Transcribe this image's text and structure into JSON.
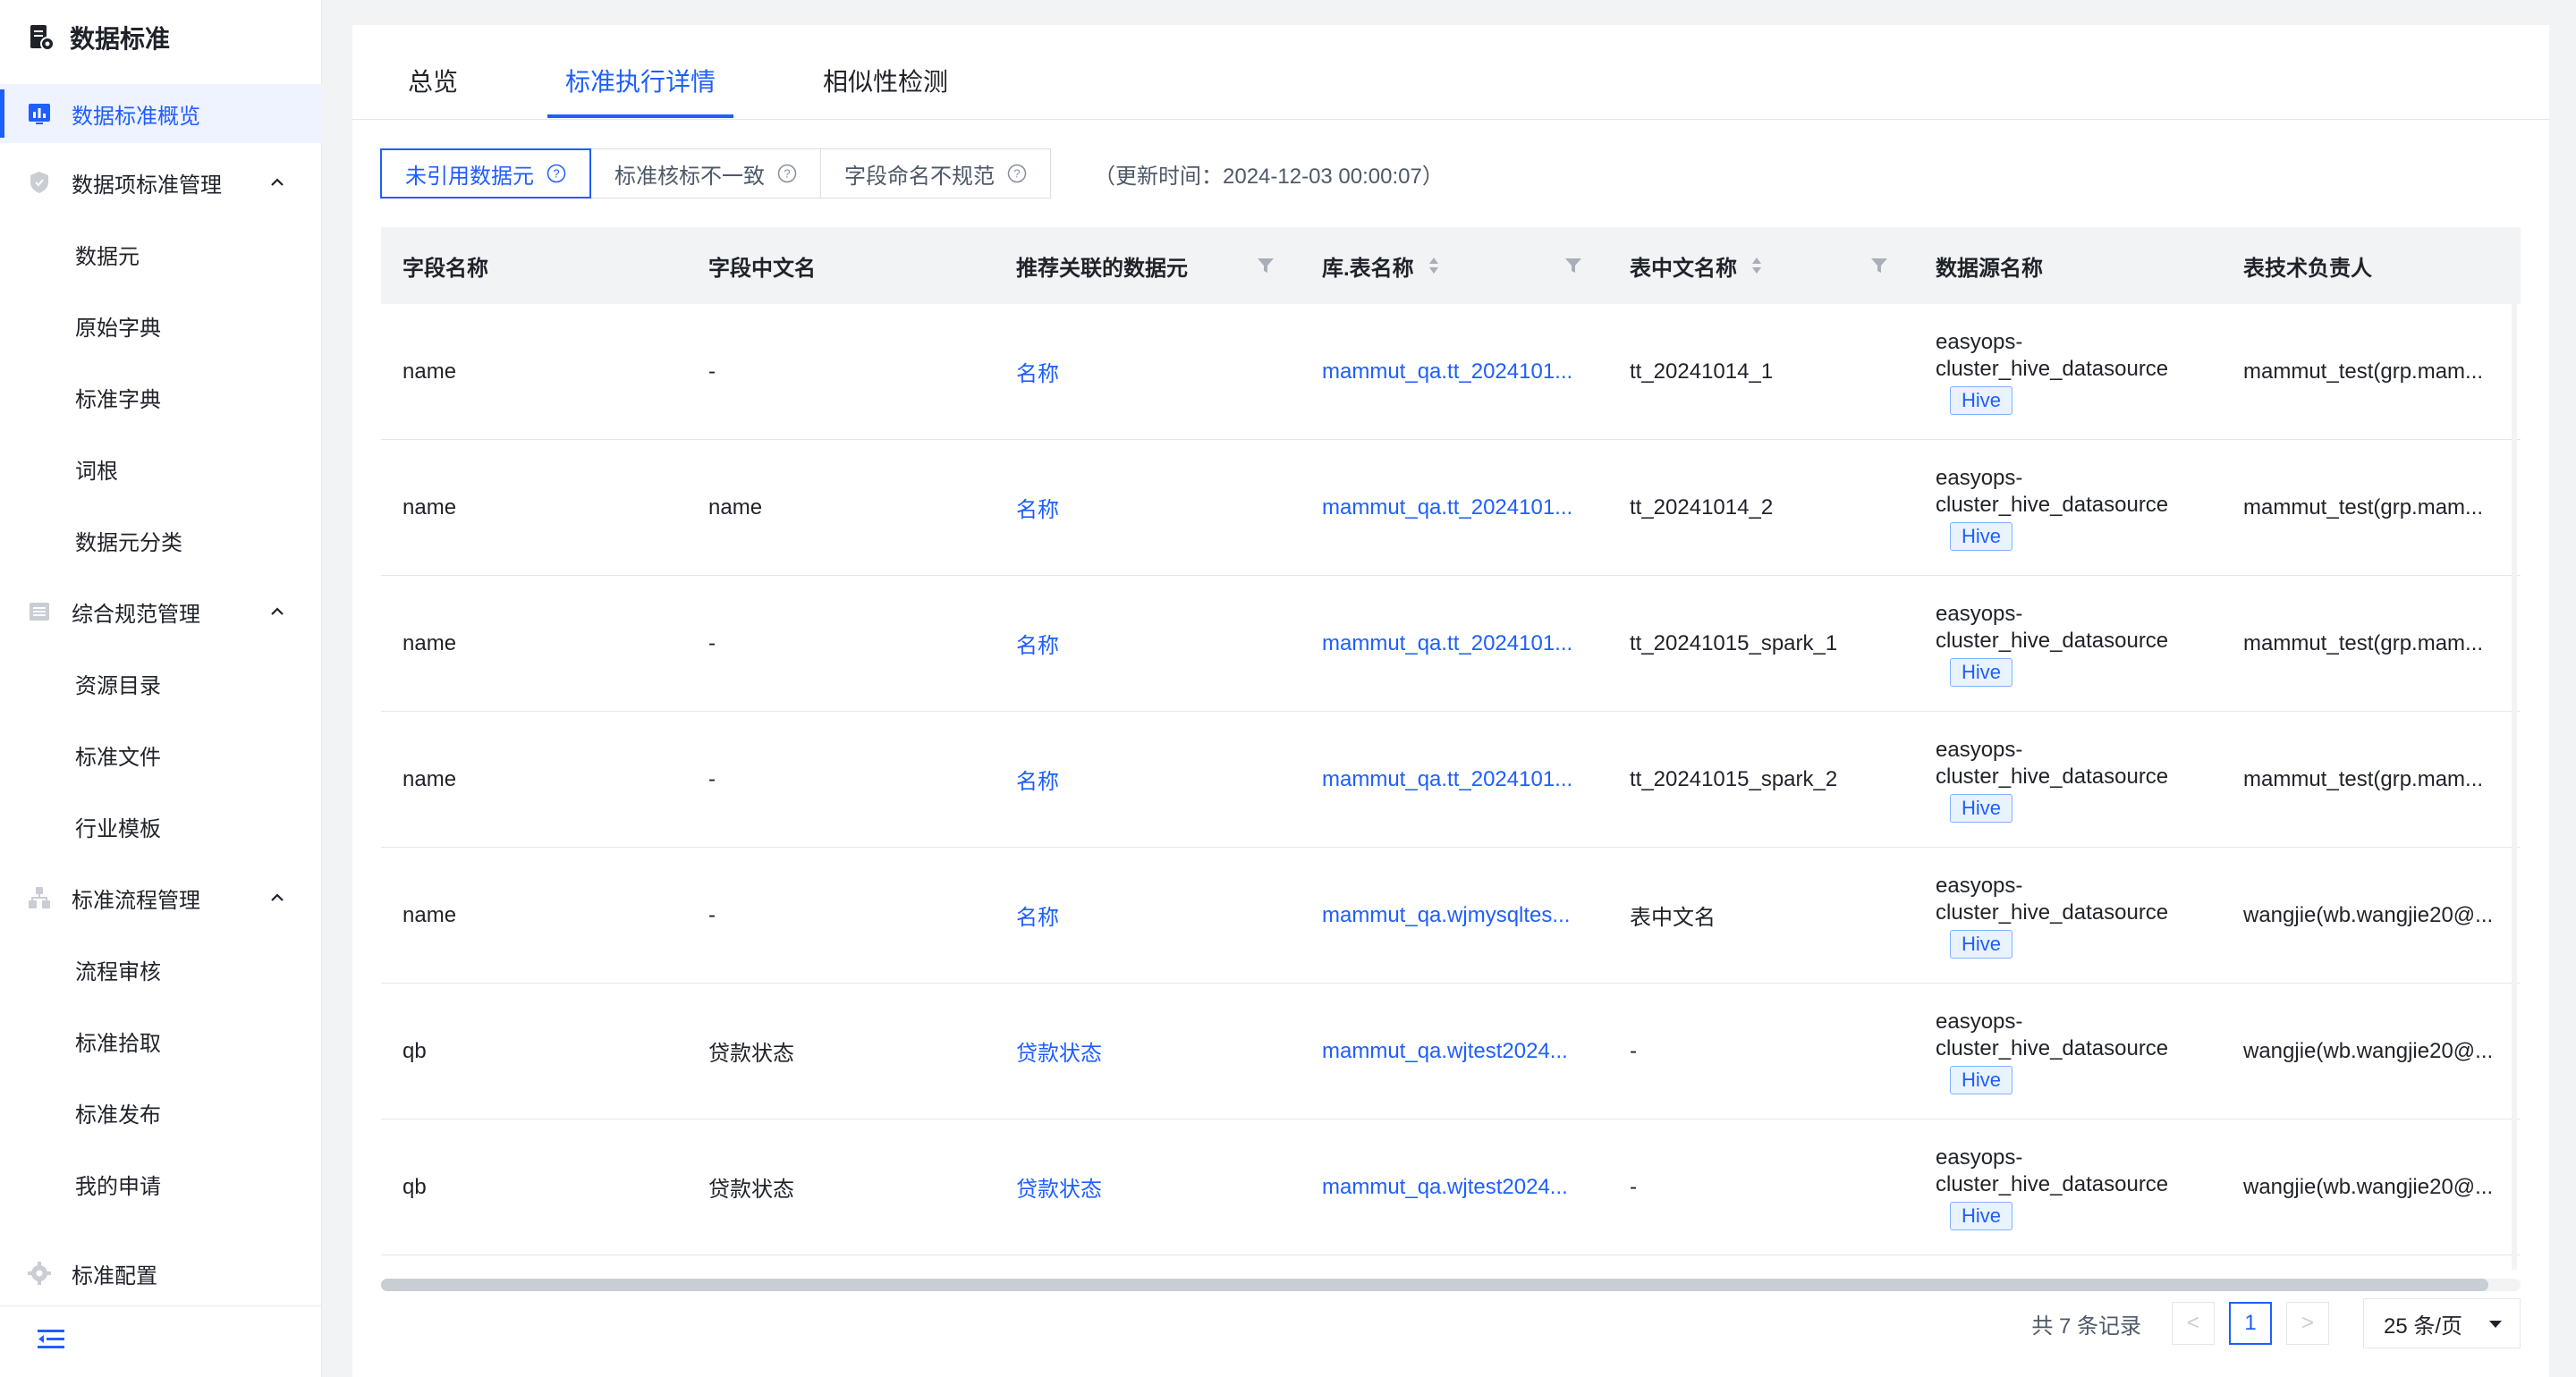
{
  "app": {
    "title": "数据标准"
  },
  "sidebar": {
    "items": [
      {
        "label": "数据标准概览",
        "type": "item",
        "active": true,
        "icon": "chart-icon"
      },
      {
        "label": "数据项标准管理",
        "type": "group",
        "icon": "shield-icon"
      },
      {
        "label": "数据元",
        "type": "sub"
      },
      {
        "label": "原始字典",
        "type": "sub"
      },
      {
        "label": "标准字典",
        "type": "sub"
      },
      {
        "label": "词根",
        "type": "sub"
      },
      {
        "label": "数据元分类",
        "type": "sub"
      },
      {
        "label": "综合规范管理",
        "type": "group",
        "icon": "list-icon"
      },
      {
        "label": "资源目录",
        "type": "sub"
      },
      {
        "label": "标准文件",
        "type": "sub"
      },
      {
        "label": "行业模板",
        "type": "sub"
      },
      {
        "label": "标准流程管理",
        "type": "group",
        "icon": "org-icon"
      },
      {
        "label": "流程审核",
        "type": "sub"
      },
      {
        "label": "标准拾取",
        "type": "sub"
      },
      {
        "label": "标准发布",
        "type": "sub"
      },
      {
        "label": "我的申请",
        "type": "sub"
      },
      {
        "label": "标准配置",
        "type": "group",
        "icon": "gear-icon"
      }
    ],
    "collapse_icon": "menu-collapse-icon"
  },
  "tabs": [
    {
      "label": "总览",
      "active": false
    },
    {
      "label": "标准执行详情",
      "active": true
    },
    {
      "label": "相似性检测",
      "active": false
    }
  ],
  "filters": [
    {
      "label": "未引用数据元",
      "active": true
    },
    {
      "label": "标准核标不一致",
      "active": false
    },
    {
      "label": "字段命名不规范",
      "active": false
    }
  ],
  "update_time": "（更新时间：2024-12-03 00:00:07）",
  "table": {
    "columns": [
      {
        "label": "字段名称",
        "sort": false,
        "filter": false
      },
      {
        "label": "字段中文名",
        "sort": false,
        "filter": false
      },
      {
        "label": "推荐关联的数据元",
        "sort": false,
        "filter": true
      },
      {
        "label": "库.表名称",
        "sort": true,
        "filter": true
      },
      {
        "label": "表中文名称",
        "sort": true,
        "filter": true
      },
      {
        "label": "数据源名称",
        "sort": false,
        "filter": false
      },
      {
        "label": "表技术负责人",
        "sort": false,
        "filter": false
      }
    ],
    "rows": [
      {
        "field": "name",
        "cn": "-",
        "rec": "名称",
        "table": "mammut_qa.tt_2024101...",
        "table_cn": "tt_20241014_1",
        "ds": "easyops-cluster_hive_datasource",
        "tag": "Hive",
        "owner": "mammut_test(grp.mam..."
      },
      {
        "field": "name",
        "cn": "name",
        "rec": "名称",
        "table": "mammut_qa.tt_2024101...",
        "table_cn": "tt_20241014_2",
        "ds": "easyops-cluster_hive_datasource",
        "tag": "Hive",
        "owner": "mammut_test(grp.mam..."
      },
      {
        "field": "name",
        "cn": "-",
        "rec": "名称",
        "table": "mammut_qa.tt_2024101...",
        "table_cn": "tt_20241015_spark_1",
        "ds": "easyops-cluster_hive_datasource",
        "tag": "Hive",
        "owner": "mammut_test(grp.mam..."
      },
      {
        "field": "name",
        "cn": "-",
        "rec": "名称",
        "table": "mammut_qa.tt_2024101...",
        "table_cn": "tt_20241015_spark_2",
        "ds": "easyops-cluster_hive_datasource",
        "tag": "Hive",
        "owner": "mammut_test(grp.mam..."
      },
      {
        "field": "name",
        "cn": "-",
        "rec": "名称",
        "table": "mammut_qa.wjmysqltes...",
        "table_cn": "表中文名",
        "ds": "easyops-cluster_hive_datasource",
        "tag": "Hive",
        "owner": "wangjie(wb.wangjie20@..."
      },
      {
        "field": "qb",
        "cn": "贷款状态",
        "rec": "贷款状态",
        "table": "mammut_qa.wjtest2024...",
        "table_cn": "-",
        "ds": "easyops-cluster_hive_datasource",
        "tag": "Hive",
        "owner": "wangjie(wb.wangjie20@..."
      },
      {
        "field": "qb",
        "cn": "贷款状态",
        "rec": "贷款状态",
        "table": "mammut_qa.wjtest2024...",
        "table_cn": "-",
        "ds": "easyops-cluster_hive_datasource",
        "tag": "Hive",
        "owner": "wangjie(wb.wangjie20@..."
      }
    ]
  },
  "pagination": {
    "total": "共 7 条记录",
    "current_page": "1",
    "prev": "<",
    "next": ">",
    "page_size": "25 条/页"
  },
  "colors": {
    "accent": "#1f5eff",
    "header_bg": "#f2f3f5",
    "tag_bg": "#e8f3ff"
  }
}
